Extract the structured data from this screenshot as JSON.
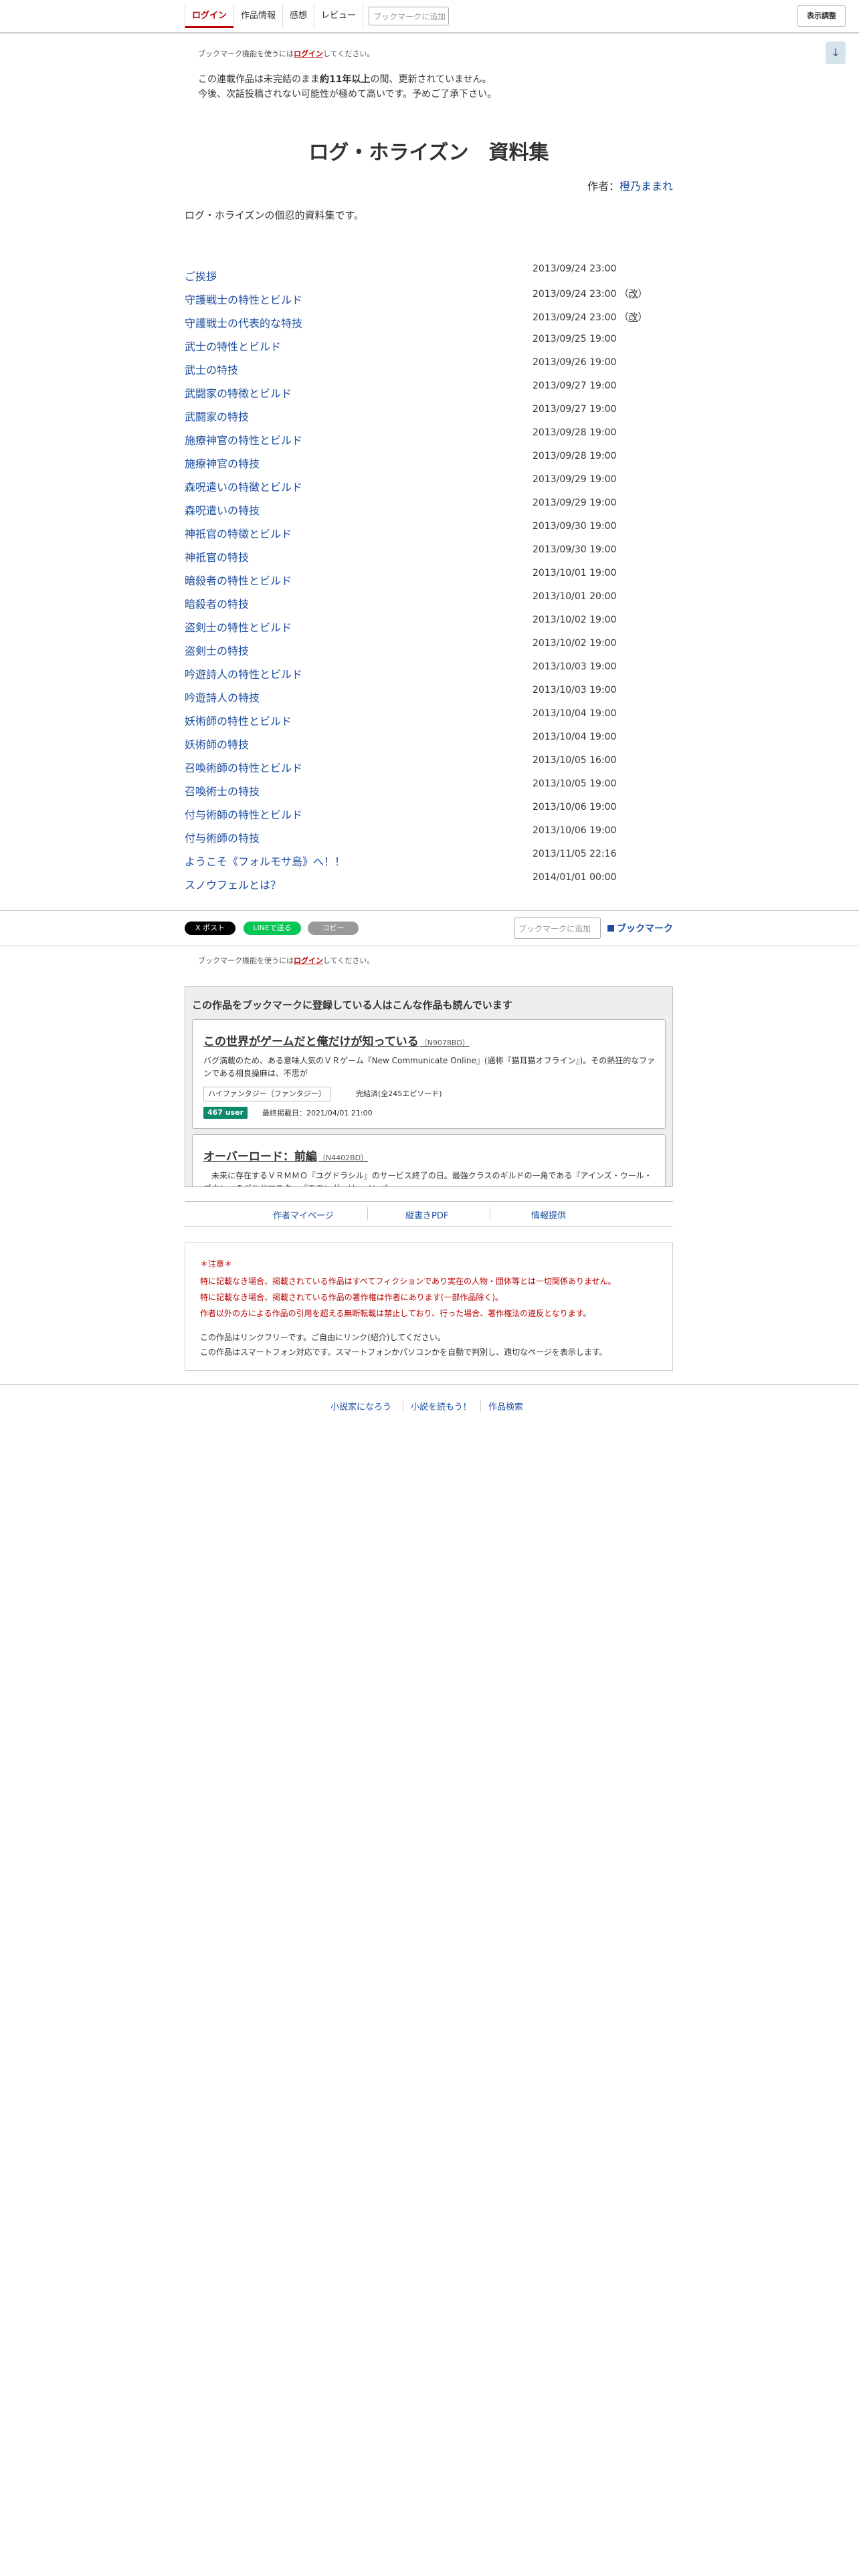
{
  "nav": {
    "login": "ログイン",
    "work_info": "作品情報",
    "impressions": "感想",
    "review": "レビュー",
    "bookmark_placeholder": "ブックマークに追加",
    "display_settings": "表示調整",
    "scroll_icon": "arrow-down-icon"
  },
  "bookmark_note": {
    "prefix": "ブックマーク機能を使うには",
    "link": "ログイン",
    "suffix": "してください。"
  },
  "warning": {
    "line1_a": "この連載作品は未完結のまま",
    "line1_b": "約11年以上",
    "line1_c": "の間、更新されていません。",
    "line2": "今後、次話投稿されない可能性が極めて高いです。予めご了承下さい。"
  },
  "novel": {
    "title": "ログ・ホライズン　資料集",
    "author_label": "作者：",
    "author_name": "橙乃ままれ",
    "description": "ログ・ホライズンの個忍的資料集です。"
  },
  "toc": [
    {
      "title": "ご挨拶",
      "date": "2013/09/24 23:00",
      "revised": ""
    },
    {
      "title": "守護戦士の特性とビルド",
      "date": "2013/09/24 23:00",
      "revised": "改"
    },
    {
      "title": "守護戦士の代表的な特技",
      "date": "2013/09/24 23:00",
      "revised": "改"
    },
    {
      "title": "武士の特性とビルド",
      "date": "2013/09/25 19:00",
      "revised": ""
    },
    {
      "title": "武士の特技",
      "date": "2013/09/26 19:00",
      "revised": ""
    },
    {
      "title": "武闘家の特徴とビルド",
      "date": "2013/09/27 19:00",
      "revised": ""
    },
    {
      "title": "武闘家の特技",
      "date": "2013/09/27 19:00",
      "revised": ""
    },
    {
      "title": "施療神官の特性とビルド",
      "date": "2013/09/28 19:00",
      "revised": ""
    },
    {
      "title": "施療神官の特技",
      "date": "2013/09/28 19:00",
      "revised": ""
    },
    {
      "title": "森呪遣いの特徴とビルド",
      "date": "2013/09/29 19:00",
      "revised": ""
    },
    {
      "title": "森呪遣いの特技",
      "date": "2013/09/29 19:00",
      "revised": ""
    },
    {
      "title": "神祇官の特徴とビルド",
      "date": "2013/09/30 19:00",
      "revised": ""
    },
    {
      "title": "神祇官の特技",
      "date": "2013/09/30 19:00",
      "revised": ""
    },
    {
      "title": "暗殺者の特性とビルド",
      "date": "2013/10/01 19:00",
      "revised": ""
    },
    {
      "title": "暗殺者の特技",
      "date": "2013/10/01 20:00",
      "revised": ""
    },
    {
      "title": "盗剣士の特性とビルド",
      "date": "2013/10/02 19:00",
      "revised": ""
    },
    {
      "title": "盗剣士の特技",
      "date": "2013/10/02 19:00",
      "revised": ""
    },
    {
      "title": "吟遊詩人の特性とビルド",
      "date": "2013/10/03 19:00",
      "revised": ""
    },
    {
      "title": "吟遊詩人の特技",
      "date": "2013/10/03 19:00",
      "revised": ""
    },
    {
      "title": "妖術師の特性とビルド",
      "date": "2013/10/04 19:00",
      "revised": ""
    },
    {
      "title": "妖術師の特技",
      "date": "2013/10/04 19:00",
      "revised": ""
    },
    {
      "title": "召喚術師の特性とビルド",
      "date": "2013/10/05 16:00",
      "revised": ""
    },
    {
      "title": "召喚術士の特技",
      "date": "2013/10/05 19:00",
      "revised": ""
    },
    {
      "title": "付与術師の特性とビルド",
      "date": "2013/10/06 19:00",
      "revised": ""
    },
    {
      "title": "付与術師の特技",
      "date": "2013/10/06 19:00",
      "revised": ""
    },
    {
      "title": "ようこそ《フォルモサ島》へ！！",
      "date": "2013/11/05 22:16",
      "revised": ""
    },
    {
      "title": "スノウフェルとは？",
      "date": "2014/01/01 00:00",
      "revised": ""
    }
  ],
  "share": {
    "x_post": "X ポスト",
    "line_send": "LINEで送る",
    "copy": "コピー",
    "bookmark_placeholder": "ブックマークに追加",
    "bookmark_button": "ブックマーク"
  },
  "recommend": {
    "heading": "この作品をブックマークに登録している人はこんな作品も読んでいます",
    "items": [
      {
        "title": "この世界がゲームだと俺だけが知っている",
        "ncode": "（N9078BD）",
        "desc": "バグ満載のため、ある意味人気のＶＲゲーム『New Communicate Online』(通称『猫耳猫オフライン』)。その熱狂的なファンである相良操麻は、不思が",
        "genre": "ハイファンタジー〔ファンタジー〕",
        "status": "完結済(全245エピソード)",
        "users": "467 user",
        "date": "最終掲載日：2021/04/01 21:00"
      },
      {
        "title": "オーバーロード：前編",
        "ncode": "（N4402BD）",
        "desc": "　未来に存在するＶＲＭＭＯ『ユグドラシル』のサービス終了の日。最強クラスのギルドの一角である『アインズ・ウール・ゴウン』のギルドマスター『モモンガ』は、メンバー",
        "genre": "",
        "status": "",
        "users": "",
        "date": ""
      }
    ]
  },
  "author_links": {
    "mypage": "作者マイページ",
    "pdf": "縦書きPDF",
    "info": "情報提供"
  },
  "notice": {
    "title": "＊注意＊",
    "red1": "特に記載なき場合、掲載されている作品はすべてフィクションであり実在の人物・団体等とは一切関係ありません。",
    "red2": "特に記載なき場合、掲載されている作品の著作権は作者にあります(一部作品除く)。",
    "red3": "作者以外の方による作品の引用を超える無断転載は禁止しており、行った場合、著作権法の違反となります。",
    "black1": "この作品はリンクフリーです。ご自由にリンク(紹介)してください。",
    "black2": "この作品はスマートフォン対応です。スマートフォンかパソコンかを自動で判別し、適切なページを表示します。"
  },
  "footer": {
    "narou": "小説家になろう",
    "yomou": "小説を読もう！",
    "search": "作品検索"
  }
}
